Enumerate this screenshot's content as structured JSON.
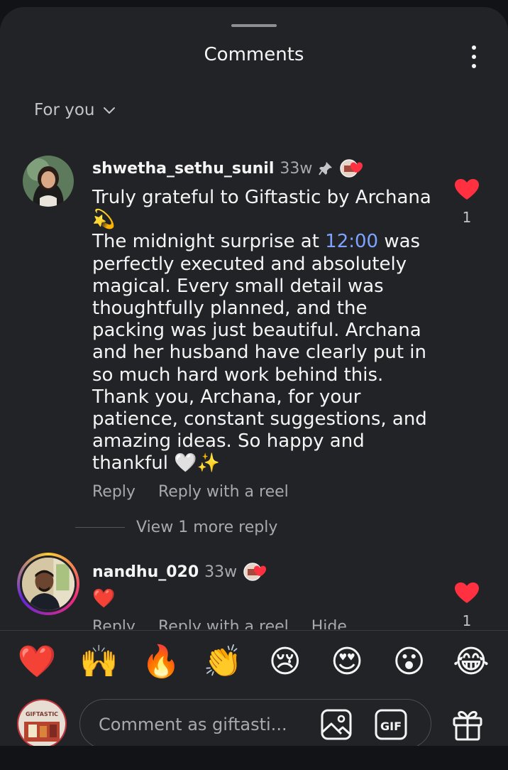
{
  "header": {
    "title": "Comments",
    "more_icon": "more-vertical-icon"
  },
  "filter": {
    "label": "For you",
    "icon": "chevron-down-icon"
  },
  "comments": [
    {
      "username": "shwetha_sethu_sunil",
      "age": "33w",
      "pinned": true,
      "liked_by_creator": true,
      "text_before_time": "Truly grateful to Giftastic by Archana 💫\nThe midnight surprise at ",
      "time_text": "12:00",
      "text_after_time": " was perfectly executed and absolutely magical. Every small detail was thoughtfully planned, and the packing was just beautiful. Archana and her husband have clearly put in so much hard work behind this. Thank you, Archana, for your patience, constant suggestions, and amazing ideas. So happy and thankful 🤍✨",
      "like_count": "1",
      "reply_label": "Reply",
      "reply_reel_label": "Reply with a reel",
      "view_more": "View 1 more reply"
    },
    {
      "username": "nandhu_020",
      "age": "33w",
      "liked_by_creator": true,
      "text": "❤️",
      "like_count": "1",
      "reply_label": "Reply",
      "reply_reel_label": "Reply with a reel",
      "hide_label": "Hide"
    }
  ],
  "emoji_bar": [
    "❤️",
    "🙌",
    "🔥",
    "👏",
    "😢",
    "😍",
    "😮",
    "😂"
  ],
  "composer": {
    "placeholder": "Comment as giftasti...",
    "avatar_text": "GIFTASTIC",
    "gif_label": "GIF"
  },
  "colors": {
    "accent_like": "#ff3040",
    "link_blue": "#7ea3ff",
    "sheet_bg": "#222327"
  }
}
